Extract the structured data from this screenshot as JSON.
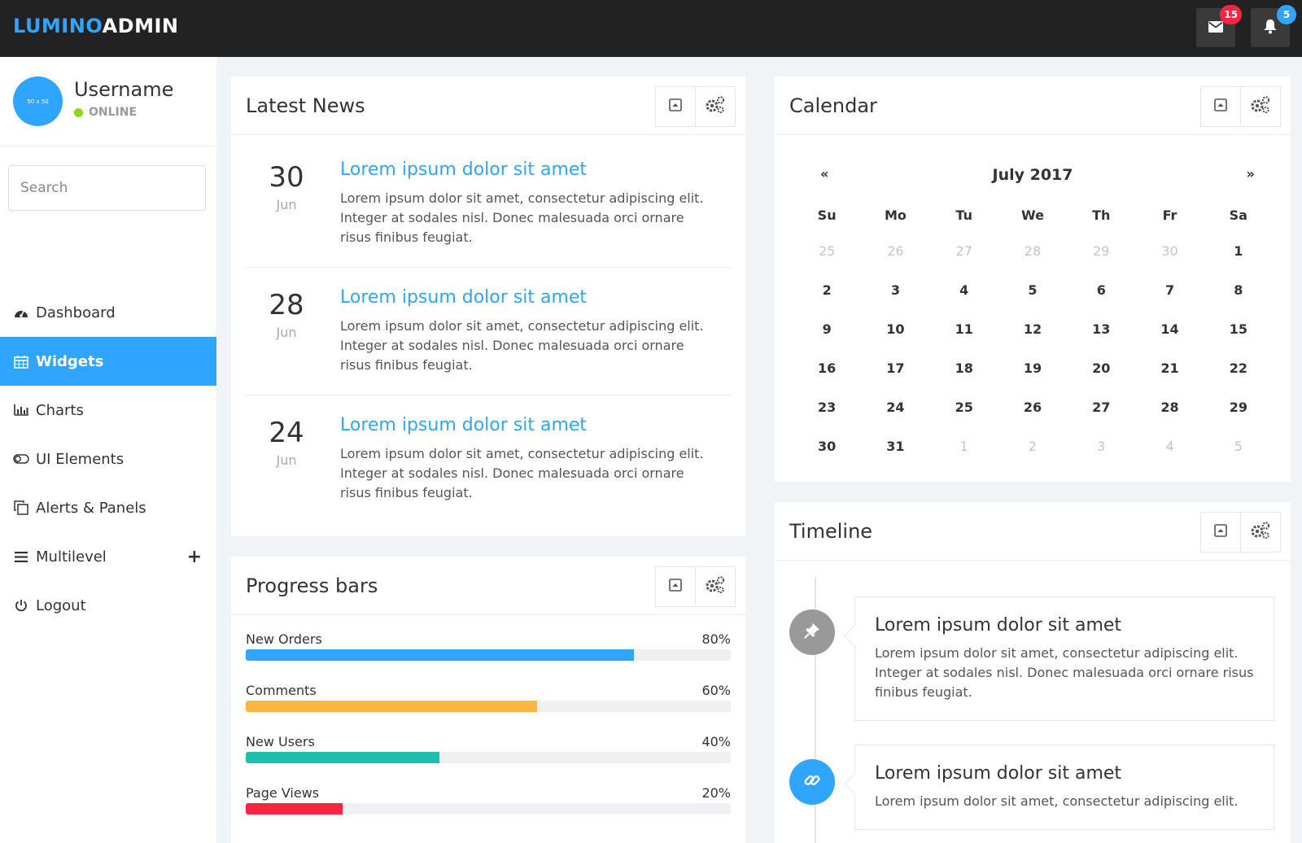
{
  "brand": {
    "part1": "LUMINO",
    "part2": "ADMIN"
  },
  "topbar": {
    "mail": {
      "icon": "envelope-icon",
      "badge": "15",
      "badge_color": "#f9243f"
    },
    "alerts": {
      "icon": "bell-icon",
      "badge": "5",
      "badge_color": "#30a5ff"
    }
  },
  "profile": {
    "avatar_text": "50 x 50",
    "username": "Username",
    "status": "ONLINE"
  },
  "search": {
    "placeholder": "Search"
  },
  "nav": {
    "dashboard": "Dashboard",
    "widgets": "Widgets",
    "charts": "Charts",
    "ui_elements": "UI Elements",
    "alerts_panels": "Alerts & Panels",
    "multilevel": "Multilevel",
    "multilevel_toggle": "+",
    "logout": "Logout"
  },
  "news": {
    "title": "Latest News",
    "items": [
      {
        "day": "30",
        "month": "Jun",
        "title": "Lorem ipsum dolor sit amet",
        "text": "Lorem ipsum dolor sit amet, consectetur adipiscing elit. Integer at sodales nisl. Donec malesuada orci ornare risus finibus feugiat."
      },
      {
        "day": "28",
        "month": "Jun",
        "title": "Lorem ipsum dolor sit amet",
        "text": "Lorem ipsum dolor sit amet, consectetur adipiscing elit. Integer at sodales nisl. Donec malesuada orci ornare risus finibus feugiat."
      },
      {
        "day": "24",
        "month": "Jun",
        "title": "Lorem ipsum dolor sit amet",
        "text": "Lorem ipsum dolor sit amet, consectetur adipiscing elit. Integer at sodales nisl. Donec malesuada orci ornare risus finibus feugiat."
      }
    ]
  },
  "progress": {
    "title": "Progress bars",
    "bars": [
      {
        "label": "New Orders",
        "pct": "80%",
        "value": 0.8,
        "color": "#30a5ff"
      },
      {
        "label": "Comments",
        "pct": "60%",
        "value": 0.6,
        "color": "#ffb53e"
      },
      {
        "label": "New Users",
        "pct": "40%",
        "value": 0.4,
        "color": "#1ebfae"
      },
      {
        "label": "Page Views",
        "pct": "20%",
        "value": 0.2,
        "color": "#f9243f"
      }
    ]
  },
  "calendar": {
    "title": "Calendar",
    "prev": "«",
    "next": "»",
    "month": "July 2017",
    "dow": [
      "Su",
      "Mo",
      "Tu",
      "We",
      "Th",
      "Fr",
      "Sa"
    ],
    "weeks": [
      [
        {
          "d": "25",
          "m": true
        },
        {
          "d": "26",
          "m": true
        },
        {
          "d": "27",
          "m": true
        },
        {
          "d": "28",
          "m": true
        },
        {
          "d": "29",
          "m": true
        },
        {
          "d": "30",
          "m": true
        },
        {
          "d": "1",
          "m": false
        }
      ],
      [
        {
          "d": "2",
          "m": false
        },
        {
          "d": "3",
          "m": false
        },
        {
          "d": "4",
          "m": false
        },
        {
          "d": "5",
          "m": false
        },
        {
          "d": "6",
          "m": false
        },
        {
          "d": "7",
          "m": false
        },
        {
          "d": "8",
          "m": false
        }
      ],
      [
        {
          "d": "9",
          "m": false
        },
        {
          "d": "10",
          "m": false
        },
        {
          "d": "11",
          "m": false
        },
        {
          "d": "12",
          "m": false
        },
        {
          "d": "13",
          "m": false
        },
        {
          "d": "14",
          "m": false
        },
        {
          "d": "15",
          "m": false
        }
      ],
      [
        {
          "d": "16",
          "m": false
        },
        {
          "d": "17",
          "m": false
        },
        {
          "d": "18",
          "m": false
        },
        {
          "d": "19",
          "m": false
        },
        {
          "d": "20",
          "m": false
        },
        {
          "d": "21",
          "m": false
        },
        {
          "d": "22",
          "m": false
        }
      ],
      [
        {
          "d": "23",
          "m": false
        },
        {
          "d": "24",
          "m": false
        },
        {
          "d": "25",
          "m": false
        },
        {
          "d": "26",
          "m": false
        },
        {
          "d": "27",
          "m": false
        },
        {
          "d": "28",
          "m": false
        },
        {
          "d": "29",
          "m": false
        }
      ],
      [
        {
          "d": "30",
          "m": false
        },
        {
          "d": "31",
          "m": false
        },
        {
          "d": "1",
          "m": true
        },
        {
          "d": "2",
          "m": true
        },
        {
          "d": "3",
          "m": true
        },
        {
          "d": "4",
          "m": true
        },
        {
          "d": "5",
          "m": true
        }
      ]
    ]
  },
  "timeline": {
    "title": "Timeline",
    "items": [
      {
        "icon": "pushpin-icon",
        "color": "#999999",
        "title": "Lorem ipsum dolor sit amet",
        "text": "Lorem ipsum dolor sit amet, consectetur adipiscing elit. Integer at sodales nisl. Donec malesuada orci ornare risus finibus feugiat."
      },
      {
        "icon": "link-icon",
        "color": "#30a5ff",
        "title": "Lorem ipsum dolor sit amet",
        "text": "Lorem ipsum dolor sit amet, consectetur adipiscing elit."
      }
    ]
  },
  "panel_tools": {
    "collapse_icon": "collapse-icon",
    "settings_icon": "settings-gears-icon"
  }
}
